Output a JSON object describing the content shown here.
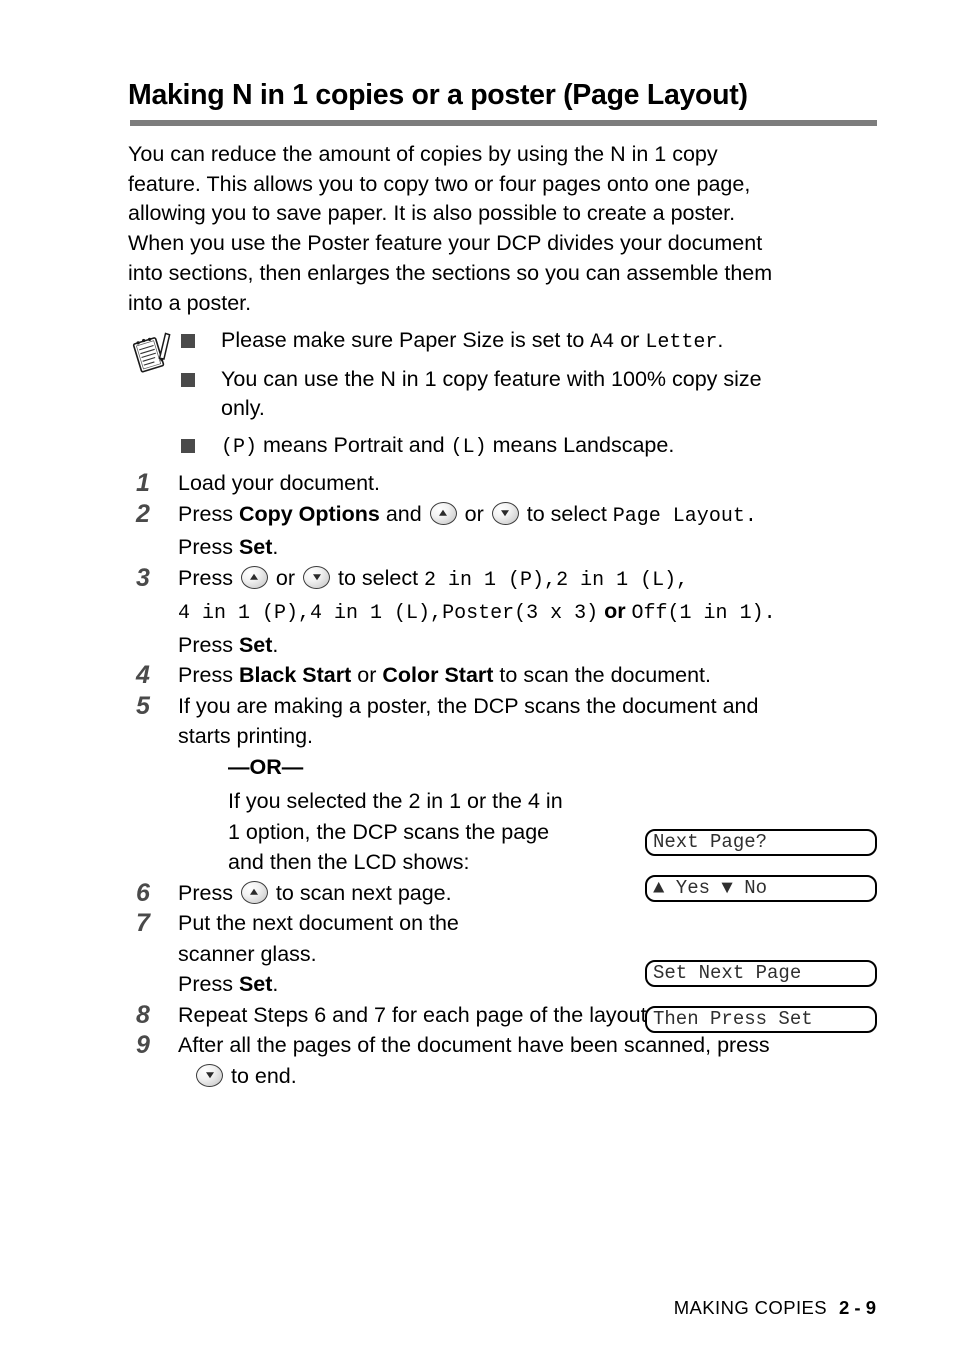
{
  "document": {
    "title": "Making N in 1 copies or a poster (Page Layout)",
    "intro": [
      "You can reduce the amount of copies by using the N in 1 copy",
      "feature. This allows you to copy two or four pages onto one page,",
      "allowing you to save paper. It is also possible to create a poster.",
      "When you use the Poster feature your DCP divides your document",
      "into sections, then enlarges the sections so you can assemble them",
      "into a poster."
    ]
  },
  "note": {
    "icon": "notepad-pencil-icon",
    "bullets": [
      {
        "parts": [
          {
            "text": "Please make sure Paper Size is set to ",
            "style": "normal"
          },
          {
            "text": "A4",
            "style": "mono"
          },
          {
            "text": " or ",
            "style": "normal"
          },
          {
            "text": "Letter",
            "style": "mono"
          },
          {
            "text": ".",
            "style": "normal"
          }
        ]
      },
      {
        "lines": [
          "You can use the N in 1 copy feature with 100% copy size",
          "only."
        ]
      },
      {
        "parts": [
          {
            "text": "(P)",
            "style": "mono"
          },
          {
            "text": " means Portrait and ",
            "style": "normal"
          },
          {
            "text": "(L)",
            "style": "mono"
          },
          {
            "text": " means Landscape.",
            "style": "normal"
          }
        ]
      }
    ]
  },
  "steps": {
    "s1": {
      "num": "1",
      "text": "Load your document."
    },
    "s2": {
      "num": "2",
      "l1a": "Press ",
      "l1b": "Copy Options",
      "l1c": " and ",
      "l1d": " or ",
      "l1e": " to select ",
      "l1f": "Page Layout.",
      "l2a": "Press ",
      "l2b": "Set",
      "l2c": "."
    },
    "s3": {
      "num": "3",
      "l1a": "Press ",
      "l1b": " or ",
      "l1c": " to select ",
      "l1d": "2 in 1 (P),",
      "l1e": "2 in 1 (L),",
      "l2a": "4 in 1 (P),",
      "l2b": "4 in 1 (L),",
      "l2c": "Poster(3 x 3)",
      "l2d": " or ",
      "l2e": "Off(1 in 1).",
      "l3a": "Press ",
      "l3b": "Set",
      "l3c": "."
    },
    "s4": {
      "num": "4",
      "a": "Press ",
      "b": "Black Start",
      "c": " or ",
      "d": "Color Start",
      "e": " to scan the document."
    },
    "s5": {
      "num": "5",
      "lines": [
        "If you are making a poster, the DCP scans the document and",
        "starts printing."
      ],
      "or": "—OR—",
      "alt_lines": [
        "If you selected the 2 in 1 or the 4 in",
        "1 option, the DCP scans the page",
        "and then the LCD shows:"
      ]
    },
    "s6": {
      "num": "6",
      "a": "Press ",
      "b": " to scan next page."
    },
    "s7": {
      "num": "7",
      "lines": [
        "Put the next document on the",
        "scanner glass."
      ],
      "pa": "Press ",
      "pb": "Set",
      "pc": "."
    },
    "s8": {
      "num": "8",
      "text": "Repeat Steps 6 and 7 for each page of the layout."
    },
    "s9": {
      "num": "9",
      "l1": "After all the pages of the document have been scanned, press",
      "l2": " to end."
    }
  },
  "lcd": {
    "box1": "Next Page?",
    "box2": "▲ Yes ▼ No",
    "box3": "Set Next Page",
    "box4": "Then Press Set"
  },
  "footer": {
    "chapter": "MAKING COPIES",
    "page": "2 - 9"
  }
}
